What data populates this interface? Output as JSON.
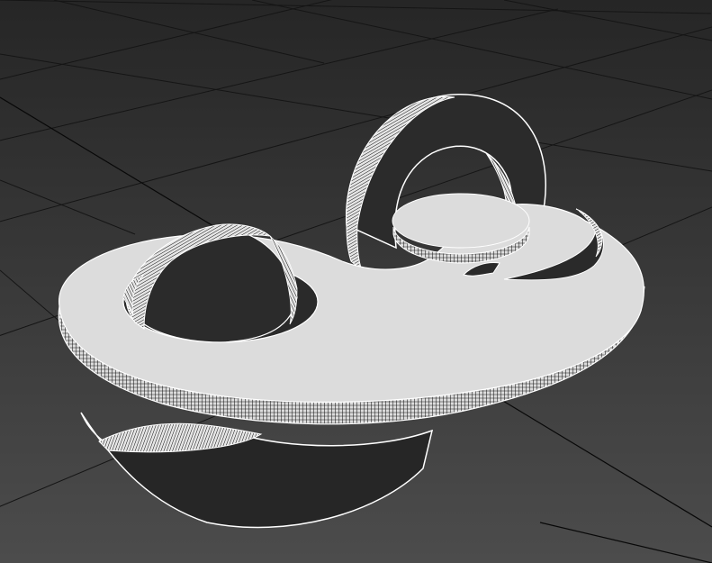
{
  "viewport": {
    "view": "perspective",
    "shading": "wireframe-on-shaded",
    "background_color_top": "#262626",
    "background_color_bottom": "#4a4a4a",
    "grid_color": "#141414",
    "grid_axis_color": "#0a0a0a",
    "object_color_light": "#dcdcdc",
    "object_color_dark": "#2a2a2a",
    "edge_color": "#ffffff",
    "wire_color": "#111111"
  },
  "objects": [
    {
      "name": "yin-yang-disk",
      "shape": "extruded swirl"
    },
    {
      "name": "upper-ring",
      "shape": "tilted ring"
    },
    {
      "name": "inner-sphere-ring",
      "shape": "half ring"
    },
    {
      "name": "small-cap",
      "shape": "cylinder"
    },
    {
      "name": "lower-swoosh",
      "shape": "curved blade"
    }
  ]
}
